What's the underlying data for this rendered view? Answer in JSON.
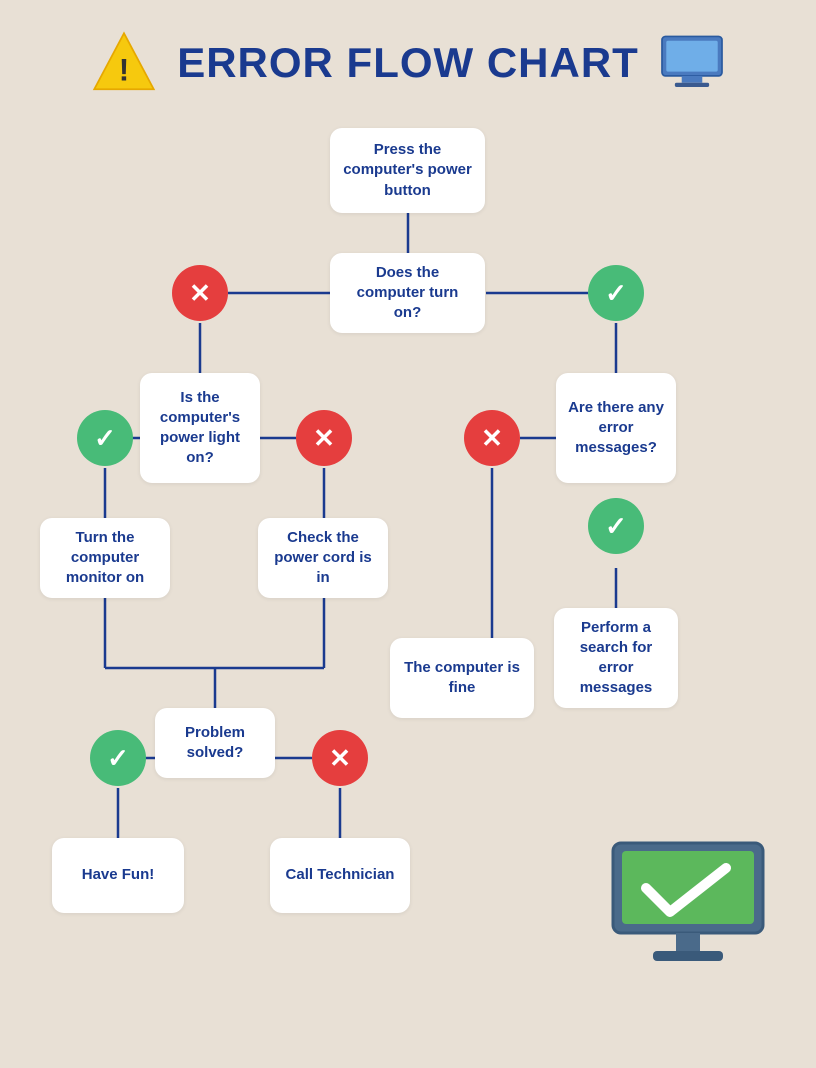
{
  "header": {
    "title": "ERROR FLOW CHART"
  },
  "boxes": {
    "start": "Press the computer's power button",
    "question1": "Does the computer turn on?",
    "question2": "Is the computer's power light on?",
    "question3": "Are there any error messages?",
    "action1": "Turn the computer monitor on",
    "action2": "Check the power cord is in",
    "action3": "Perform a search for error messages",
    "question4": "Problem solved?",
    "end1": "Have Fun!",
    "end2": "Call Technician",
    "end3": "The computer is fine"
  },
  "circles": {
    "cross": "✕",
    "check": "✓"
  },
  "colors": {
    "background": "#e8e0d5",
    "title": "#1a3a8f",
    "line": "#1a3a8f",
    "red": "#e53e3e",
    "green": "#48bb78",
    "box_bg": "#ffffff"
  }
}
